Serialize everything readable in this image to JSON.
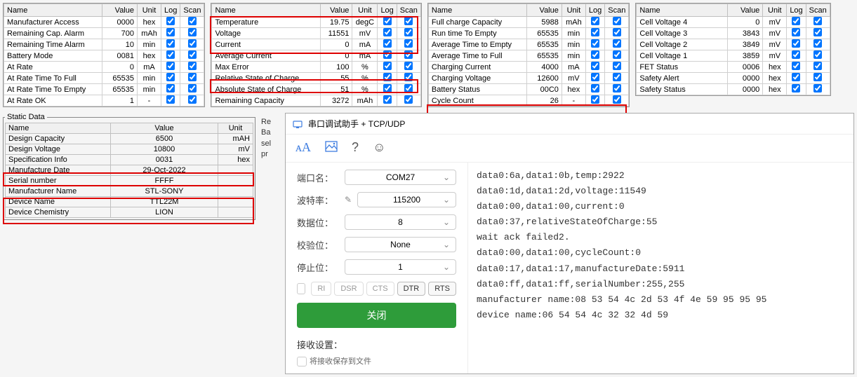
{
  "grids_headers": {
    "name": "Name",
    "value": "Value",
    "unit": "Unit",
    "log": "Log",
    "scan": "Scan"
  },
  "grid1": [
    {
      "name": "Manufacturer Access",
      "value": "0000",
      "unit": "hex"
    },
    {
      "name": "Remaining Cap. Alarm",
      "value": "700",
      "unit": "mAh"
    },
    {
      "name": "Remaining Time Alarm",
      "value": "10",
      "unit": "min"
    },
    {
      "name": "Battery Mode",
      "value": "0081",
      "unit": "hex"
    },
    {
      "name": "At Rate",
      "value": "0",
      "unit": "mA"
    },
    {
      "name": "At Rate Time To Full",
      "value": "65535",
      "unit": "min"
    },
    {
      "name": "At Rate Time To Empty",
      "value": "65535",
      "unit": "min"
    },
    {
      "name": "At Rate OK",
      "value": "1",
      "unit": "-"
    }
  ],
  "grid2": [
    {
      "name": "Temperature",
      "value": "19.75",
      "unit": "degC",
      "hl": true
    },
    {
      "name": "Voltage",
      "value": "11551",
      "unit": "mV",
      "hl": true
    },
    {
      "name": "Current",
      "value": "0",
      "unit": "mA",
      "hl": true
    },
    {
      "name": "Average Current",
      "value": "0",
      "unit": "mA"
    },
    {
      "name": "Max Error",
      "value": "100",
      "unit": "%"
    },
    {
      "name": "Relative State of Charge",
      "value": "55",
      "unit": "%",
      "hl": true
    },
    {
      "name": "Absolute State of Charge",
      "value": "51",
      "unit": "%"
    },
    {
      "name": "Remaining Capacity",
      "value": "3272",
      "unit": "mAh"
    }
  ],
  "grid3": [
    {
      "name": "Full charge Capacity",
      "value": "5988",
      "unit": "mAh"
    },
    {
      "name": "Run time To Empty",
      "value": "65535",
      "unit": "min"
    },
    {
      "name": "Average Time to Empty",
      "value": "65535",
      "unit": "min"
    },
    {
      "name": "Average Time to Full",
      "value": "65535",
      "unit": "min"
    },
    {
      "name": "Charging Current",
      "value": "4000",
      "unit": "mA"
    },
    {
      "name": "Charging Voltage",
      "value": "12600",
      "unit": "mV"
    },
    {
      "name": "Battery Status",
      "value": "00C0",
      "unit": "hex"
    },
    {
      "name": "Cycle Count",
      "value": "26",
      "unit": "-",
      "hl": true
    }
  ],
  "grid4": [
    {
      "name": "Cell Voltage 4",
      "value": "0",
      "unit": "mV"
    },
    {
      "name": "Cell Voltage 3",
      "value": "3843",
      "unit": "mV"
    },
    {
      "name": "Cell Voltage 2",
      "value": "3849",
      "unit": "mV"
    },
    {
      "name": "Cell Voltage 1",
      "value": "3859",
      "unit": "mV"
    },
    {
      "name": "FET Status",
      "value": "0006",
      "unit": "hex"
    },
    {
      "name": "Safety Alert",
      "value": "0000",
      "unit": "hex"
    },
    {
      "name": "Safety Status",
      "value": "0000",
      "unit": "hex"
    }
  ],
  "static_data": {
    "legend": "Static Data",
    "headers": {
      "name": "Name",
      "value": "Value",
      "unit": "Unit"
    },
    "rows": [
      {
        "name": "Design Capacity",
        "value": "6500",
        "unit": "mAH"
      },
      {
        "name": "Design Voltage",
        "value": "10800",
        "unit": "mV"
      },
      {
        "name": "Specification Info",
        "value": "0031",
        "unit": "hex"
      },
      {
        "name": "Manufacture Date",
        "value": "29-Oct-2022",
        "unit": "",
        "hl": true
      },
      {
        "name": "Serial number",
        "value": "FFFF",
        "unit": ""
      },
      {
        "name": "Manufacturer Name",
        "value": "STL-SONY",
        "unit": "",
        "hl": true
      },
      {
        "name": "Device Name",
        "value": "TTL22M",
        "unit": "",
        "hl": true
      },
      {
        "name": "Device Chemistry",
        "value": "LION",
        "unit": ""
      }
    ]
  },
  "cropped_sidebar": [
    "Re",
    "Ba",
    "sel",
    "pr"
  ],
  "serial": {
    "title": "串口调试助手 + TCP/UDP",
    "labels": {
      "port": "端口名：",
      "baud": "波特率：",
      "data": "数据位：",
      "parity": "校验位：",
      "stop": "停止位：",
      "recv": "接收设置：",
      "recv_opt": "将接收保存到文件"
    },
    "values": {
      "port": "COM27",
      "baud": "115200",
      "data": "8",
      "parity": "None",
      "stop": "1"
    },
    "flags": [
      "RI",
      "DSR",
      "CTS",
      "DTR",
      "RTS"
    ],
    "close": "关闭",
    "log": [
      "data0:6a,data1:0b,temp:2922",
      "data0:1d,data1:2d,voltage:11549",
      "data0:00,data1:00,current:0",
      "data0:37,relativeStateOfCharge:55",
      "wait ack failed2.",
      "data0:00,data1:00,cycleCount:0",
      "data0:17,data1:17,manufactureDate:5911",
      "data0:ff,data1:ff,serialNumber:255,255",
      "manufacturer name:08 53 54 4c 2d 53 4f 4e 59 95 95 95",
      "device name:06 54 54 4c 32 32 4d 59"
    ]
  }
}
